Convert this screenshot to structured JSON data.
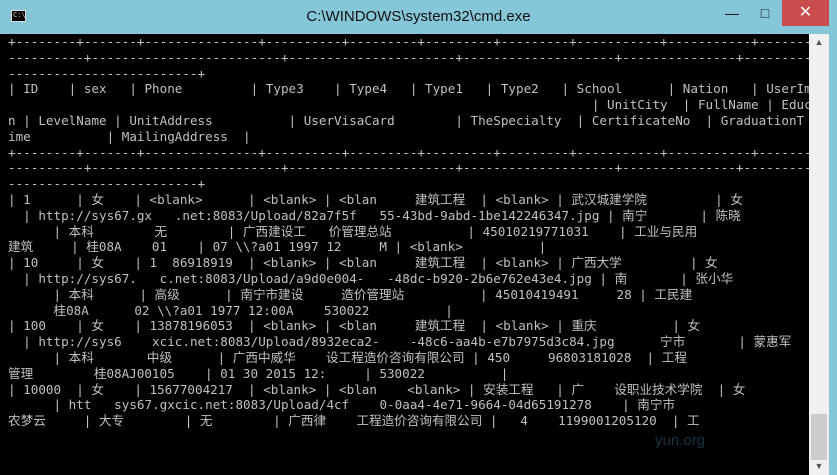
{
  "window": {
    "title": "C:\\WINDOWS\\system32\\cmd.exe",
    "icon_glyph": "C:\\",
    "controls": {
      "minimize": "—",
      "maximize": "□",
      "close": "✕"
    }
  },
  "console_lines": [
    "+--------+-------+---------------+----------+---------+---------+---------+-----------+-----------+---------",
    "----------+-------------------------+----------------------+--------------------+---------------+----------",
    "-------------------------+",
    "| ID    | sex   | Phone         | Type3    | Type4   | Type1   | Type2   | School      | Nation   | UserImg",
    "                                                                             | UnitCity  | FullName | Educatio",
    "n | LevelName | UnitAddress          | UserVisaCard        | TheSpecialty  | CertificateNo  | GraduationT",
    "ime          | MailingAddress  |",
    "+--------+-------+---------------+----------+---------+---------+---------+-----------+-----------+---------",
    "----------+-------------------------+----------------------+--------------------+---------------+----------",
    "-------------------------+",
    "| 1      | 女    | <blank>      | <blank> | <blan     建筑工程  | <blank> | 武汉城建学院         | 女",
    "  | http://sys67.gx   .net:8083/Upload/82a7f5f   55-43bd-9abd-1be142246347.jpg | 南宁       | 陈晓",
    "      | 本科        无        | 广西建设工   价管理总站          | 45010219771031    | 工业与民用",
    "建筑     | 桂08A    01    | 07 \\\\?a01 1997 12     M | <blank>          |",
    "| 10     | 女    | 1  86918919  | <blank> | <blan     建筑工程  | <blank> | 广西大学         | 女",
    "  | http://sys67.   c.net:8083/Upload/a9d0e004-   -48dc-b920-2b6e762e43e4.jpg | 南       | 张小华",
    "      | 本科      | 高级      | 南宁市建设     造价管理站          | 45010419491     28 | 工民建",
    "      桂08A      02 \\\\?a01 1977 12:00A    530022          |",
    "| 100    | 女    | 13878196053  | <blank> | <blan     建筑工程  | <blank> | 重庆          | 女",
    "  | http://sys6    xcic.net:8083/Upload/8932eca2-    -48c6-aa4b-e7b7975d3c84.jpg      宁市       | 蒙惠军",
    "      | 本科       中级      | 广西中威华    设工程造价咨询有限公司 | 450     96803181028  | 工程",
    "管理        桂08AJ00105    | 01 30 2015 12:     | 530022          |",
    "| 10000  | 女    | 15677004217  | <blank> | <blan    <blank> | 安装工程   | 广    设职业技术学院  | 女",
    "      | htt   sys67.gxcic.net:8083/Upload/4cf    0-0aa4-4e71-9664-04d65191278    | 南宁市",
    "农梦云     | 大专        | 无        | 广西律    工程造价咨询有限公司 |   4    1199001205120  | 工"
  ],
  "watermark": "yun.org"
}
